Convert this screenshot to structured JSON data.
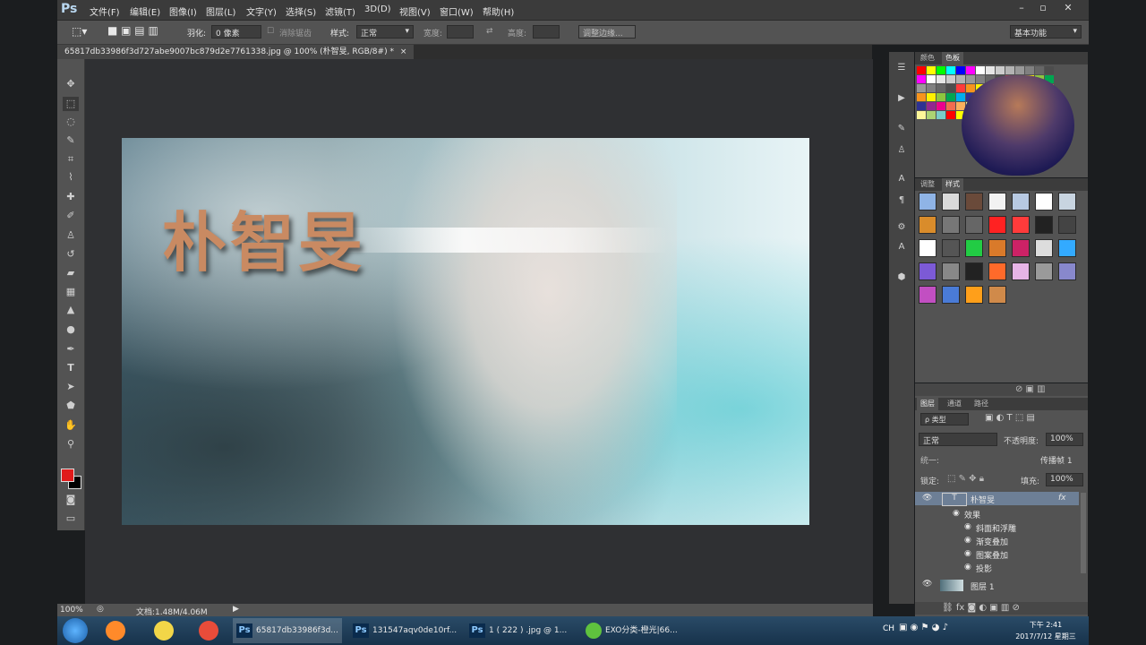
{
  "app": {
    "logo": "Ps",
    "menu": [
      "文件(F)",
      "编辑(E)",
      "图像(I)",
      "图层(L)",
      "文字(Y)",
      "选择(S)",
      "滤镜(T)",
      "3D(D)",
      "视图(V)",
      "窗口(W)",
      "帮助(H)"
    ],
    "window_controls": [
      "–",
      "▫",
      "✕"
    ]
  },
  "options": {
    "feather_label": "羽化:",
    "feather_value": "0 像素",
    "antialias_label": "消除锯齿",
    "style_label": "样式:",
    "style_value": "正常",
    "width_label": "宽度:",
    "height_label": "高度:",
    "refine_edge": "调整边缘...",
    "workspace": "基本功能"
  },
  "document": {
    "tab_title": "65817db33986f3d727abe9007bc879d2e7761338.jpg @ 100% (朴智旻, RGB/8#) *",
    "close": "×",
    "art_text": "朴智旻"
  },
  "status": {
    "zoom": "100%",
    "doc_info": "文档:1.48M/4.06M"
  },
  "panels": {
    "color_tabs": [
      "颜色",
      "色板"
    ],
    "adjust_tabs": [
      "调整",
      "样式"
    ],
    "layers_tabs": [
      "图层",
      "通道",
      "路径"
    ],
    "kind_filter": "ρ 类型",
    "blend_mode": "正常",
    "opacity_label": "不透明度:",
    "opacity_value": "100%",
    "unify_label": "统一:",
    "propagate_label": "传播帧 1",
    "lock_label": "锁定:",
    "fill_label": "填充:",
    "fill_value": "100%",
    "layers": [
      {
        "name": "朴智旻",
        "type": "text",
        "fx": "fx"
      },
      {
        "name": "效果",
        "type": "effects-header"
      },
      {
        "name": "斜面和浮雕",
        "type": "effect"
      },
      {
        "name": "渐变叠加",
        "type": "effect"
      },
      {
        "name": "图案叠加",
        "type": "effect"
      },
      {
        "name": "投影",
        "type": "effect"
      },
      {
        "name": "图层 1",
        "type": "pixel"
      }
    ]
  },
  "taskbar": {
    "items": [
      {
        "label": "65817db33986f3d..."
      },
      {
        "label": "131547aqv0de10rf..."
      },
      {
        "label": "1 ( 222 ) .jpg @ 1..."
      },
      {
        "label": "EXO分类-橙光|66..."
      }
    ],
    "tray_lang": "CH",
    "clock_time": "下午 2:41",
    "clock_date": "2017/7/12 星期三"
  },
  "colors": {
    "foreground": "#e01b1b",
    "background": "#000000"
  }
}
